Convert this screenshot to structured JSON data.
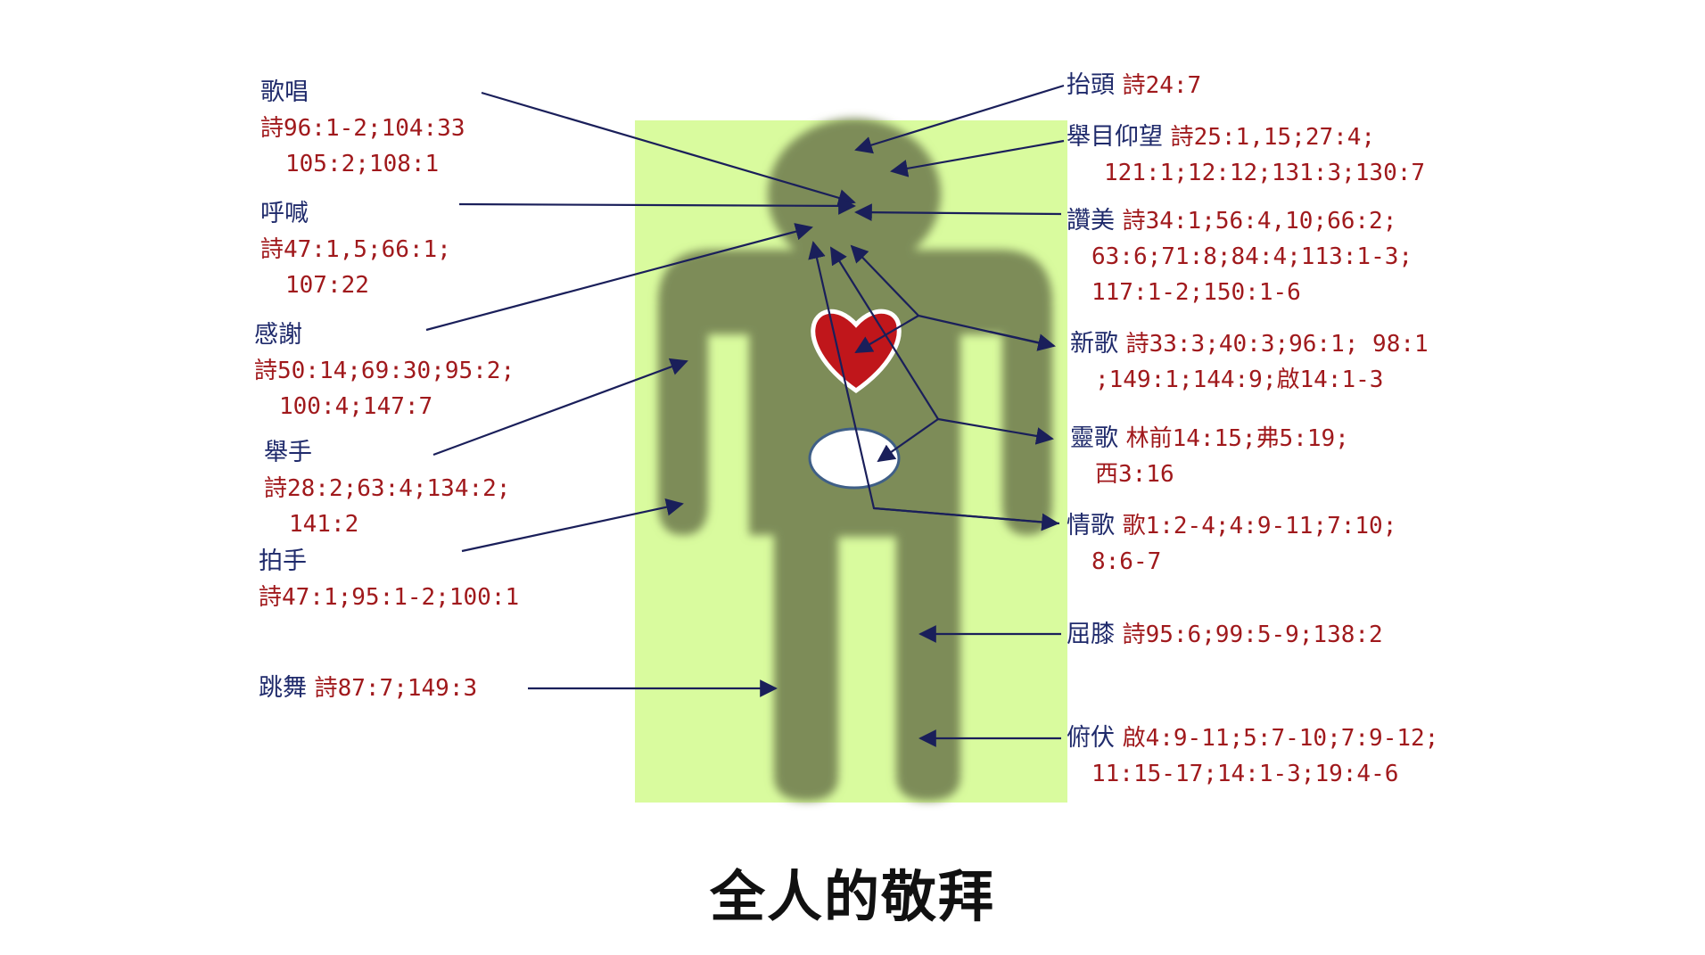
{
  "title": "全人的敬拜",
  "colors": {
    "background_panel": "#d9fb9e",
    "body": "#7d8c58",
    "heart": "#c0161b",
    "term_text": "#1f2a6b",
    "ref_text": "#a0191c",
    "arrow": "#1a1f5a"
  },
  "left_labels": [
    {
      "term": "歌唱",
      "refs": [
        "詩96:1-2;104:33",
        "105:2;108:1"
      ]
    },
    {
      "term": "呼喊",
      "refs": [
        "詩47:1,5;66:1;",
        "107:22"
      ]
    },
    {
      "term": "感謝",
      "refs": [
        "詩50:14;69:30;95:2;",
        "100:4;147:7"
      ]
    },
    {
      "term": "舉手",
      "refs": [
        "詩28:2;63:4;134:2;",
        "141:2"
      ]
    },
    {
      "term": "拍手",
      "refs": [
        "詩47:1;95:1-2;100:1"
      ]
    },
    {
      "term": "跳舞",
      "inline_ref": "詩87:7;149:3"
    }
  ],
  "right_labels": [
    {
      "term": "抬頭",
      "inline_ref": "詩24:7"
    },
    {
      "term": "舉目仰望",
      "inline_ref": "詩25:1,15;27:4;",
      "refs": [
        "121:1;12:12;131:3;130:7"
      ]
    },
    {
      "term": "讚美",
      "inline_ref": "詩34:1;56:4,10;66:2;",
      "refs": [
        "63:6;71:8;84:4;113:1-3;",
        "117:1-2;150:1-6"
      ]
    },
    {
      "term": "新歌",
      "inline_ref": "詩33:3;40:3;96:1; 98:1",
      "refs": [
        ";149:1;144:9;啟14:1-3"
      ]
    },
    {
      "term": "靈歌",
      "inline_ref": "林前14:15;弗5:19;",
      "refs": [
        "西3:16"
      ]
    },
    {
      "term": "情歌",
      "inline_ref": "歌1:2-4;4:9-11;7:10;",
      "refs": [
        "8:6-7"
      ]
    },
    {
      "term": "屈膝",
      "inline_ref": "詩95:6;99:5-9;138:2"
    },
    {
      "term": "俯伏",
      "inline_ref": "啟4:9-11;5:7-10;7:9-12;",
      "refs": [
        "11:15-17;14:1-3;19:4-6"
      ]
    }
  ]
}
